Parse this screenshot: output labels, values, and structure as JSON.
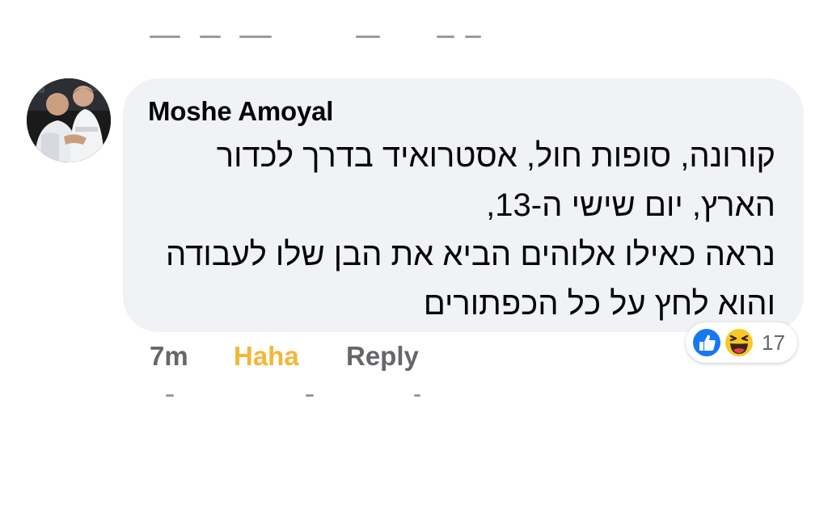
{
  "comment": {
    "author": "Moshe Amoyal",
    "lines": [
      "קורונה, סופות חול, אסטרואיד בדרך לכדור",
      "הארץ, יום שישי ה-13,",
      "נראה כאילו אלוהים הביא את הבן שלו לעבודה",
      "והוא לחץ על כל הכפתורים"
    ]
  },
  "actions": {
    "time": "7m",
    "reaction_label": "Haha",
    "reply_label": "Reply"
  },
  "reactions": {
    "icons": [
      "like-icon",
      "haha-icon"
    ],
    "count": "17"
  },
  "colors": {
    "bubble": "#f0f2f5",
    "haha_text": "#f2b736",
    "meta_text": "#65676b",
    "like_blue": "#1877f2",
    "haha_yellow": "#f7c928"
  }
}
